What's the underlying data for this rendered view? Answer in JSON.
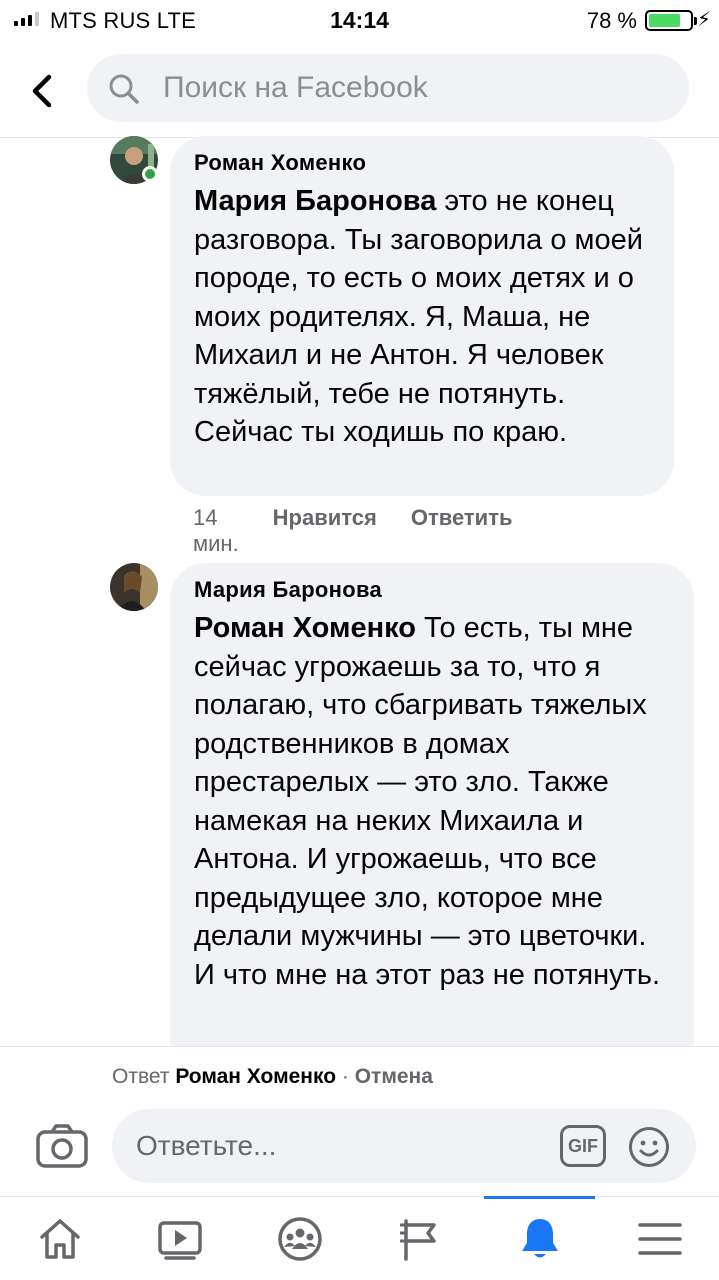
{
  "status_bar": {
    "carrier": "MTS RUS  LTE",
    "time": "14:14",
    "battery": "78 %",
    "battery_level": 0.78
  },
  "header": {
    "search_placeholder": "Поиск на Facebook"
  },
  "comments": [
    {
      "author": "Роман Хоменко",
      "mention": "Мария Баронова",
      "text": " это не конец разговора. Ты заговорила о моей породе, то есть о моих детях и о моих родителях. Я, Маша, не Михаил и не Антон. Я человек тяжёлый, тебе не потянуть. Сейчас ты ходишь по краю.",
      "time": "14 мин.",
      "like": "Нравится",
      "reply": "Ответить",
      "online": true
    },
    {
      "author": "Мария Баронова",
      "mention": "Роман Хоменко",
      "text": " То есть, ты мне сейчас угрожаешь за то, что я полагаю, что сбагривать тяжелых родственников в домах престарелых — это зло. Также намекая на неких Михаила и Антона. И угрожаешь, что все предыдущее зло, которое мне делали мужчины — это цветочки. И что мне на этот раз не потянуть."
    }
  ],
  "reply_bar": {
    "reply_prefix": "Ответ ",
    "reply_name": "Роман Хоменко",
    "separator": " · ",
    "cancel": "Отмена",
    "placeholder": "Ответьте...",
    "gif": "GIF"
  },
  "tabs": [
    {
      "icon": "home-icon"
    },
    {
      "icon": "watch-icon"
    },
    {
      "icon": "groups-icon"
    },
    {
      "icon": "pages-flag-icon"
    },
    {
      "icon": "notifications-bell-icon",
      "active": true
    },
    {
      "icon": "menu-icon"
    }
  ],
  "colors": {
    "accent": "#1877f2",
    "bubble": "#f0f2f5",
    "secondary_text": "#65676b",
    "online": "#31a24c",
    "battery": "#4cd964"
  }
}
